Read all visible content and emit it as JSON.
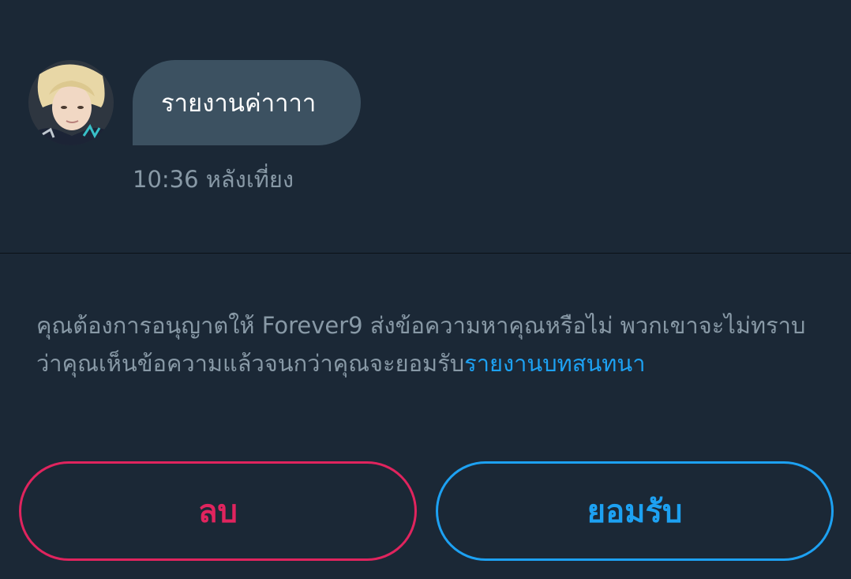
{
  "message": {
    "text": "รายงานค่าาาา",
    "time": "10:36 หลังเที่ยง"
  },
  "notice": {
    "text": "คุณต้องการอนุญาตให้ Forever9 ส่งข้อความหาคุณหรือไม่ พวกเขาจะไม่ทราบว่าคุณเห็นข้อความแล้วจนกว่าคุณจะยอมรับ",
    "link": "รายงานบทสนทนา"
  },
  "actions": {
    "delete_label": "ลบ",
    "accept_label": "ยอมรับ"
  },
  "colors": {
    "background": "#1b2836",
    "bubble": "#3c5161",
    "delete": "#e0245e",
    "accept": "#1da1f2"
  }
}
